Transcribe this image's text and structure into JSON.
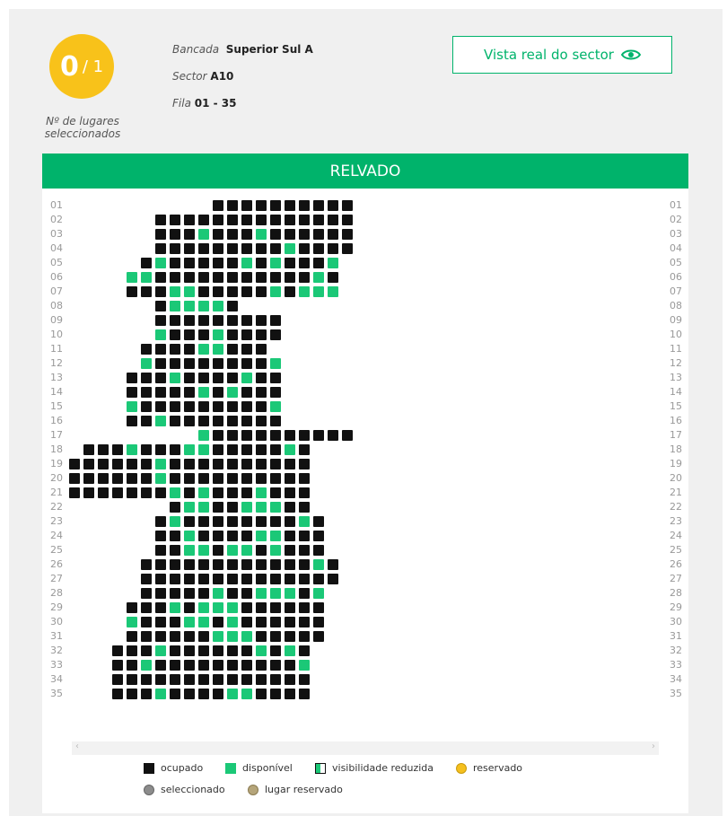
{
  "counter": {
    "selected": "0",
    "total": "/ 1",
    "label_line1": "Nº de lugares",
    "label_line2": "seleccionados"
  },
  "info": {
    "bancada_key": "Bancada",
    "bancada_value": "Superior Sul A",
    "sector_key": "Sector",
    "sector_value": "A10",
    "fila_key": "Fila",
    "fila_value": "01 - 35"
  },
  "view_button": {
    "label": "Vista real do sector",
    "icon": "eye-icon"
  },
  "pitch_label": "RELVADO",
  "rows": [
    {
      "label": "01",
      "start": 5,
      "seats": "oooooooooo"
    },
    {
      "label": "02",
      "start": 1,
      "seats": "oooooooooooooo"
    },
    {
      "label": "03",
      "start": 1,
      "seats": "oooaoooaoooooo"
    },
    {
      "label": "04",
      "start": 1,
      "seats": "oooooooooaoooo"
    },
    {
      "label": "05",
      "start": 0,
      "seats": "oaoooooaoaoooa"
    },
    {
      "label": "06",
      "start": -1,
      "seats": "aaoooooooooooao"
    },
    {
      "label": "07",
      "start": -1,
      "seats": "oooaaoooooaoaaa"
    },
    {
      "label": "08",
      "start": 1,
      "seats": "oaaaao"
    },
    {
      "label": "09",
      "start": 1,
      "seats": "ooooooooo"
    },
    {
      "label": "10",
      "start": 1,
      "seats": "aoooaoooo"
    },
    {
      "label": "11",
      "start": 0,
      "seats": "ooooaaooo"
    },
    {
      "label": "12",
      "start": 0,
      "seats": "aooooooooa"
    },
    {
      "label": "13",
      "start": -1,
      "seats": "oooaooooaoo"
    },
    {
      "label": "14",
      "start": -1,
      "seats": "oooooaoaooo"
    },
    {
      "label": "15",
      "start": -1,
      "seats": "aoooooooooa"
    },
    {
      "label": "16",
      "start": -1,
      "seats": "ooaoooooooo"
    },
    {
      "label": "17",
      "start": 4,
      "seats": "aoooooooooo"
    },
    {
      "label": "18",
      "start": -4,
      "seats": "oooaoooaaoooooao"
    },
    {
      "label": "19",
      "start": -5,
      "seats": "ooooooaoooooooooo"
    },
    {
      "label": "20",
      "start": -5,
      "seats": "ooooooaoooooooooo"
    },
    {
      "label": "21",
      "start": -5,
      "seats": "oooooooaoaoooaooo"
    },
    {
      "label": "22",
      "start": 2,
      "seats": "oaaooaaaoo"
    },
    {
      "label": "23",
      "start": 1,
      "seats": "oaooooooooao"
    },
    {
      "label": "24",
      "start": 1,
      "seats": "ooaooooaaooo"
    },
    {
      "label": "25",
      "start": 1,
      "seats": "ooaaoaaoaooo"
    },
    {
      "label": "26",
      "start": 0,
      "seats": "ooooooooooooao"
    },
    {
      "label": "27",
      "start": 0,
      "seats": "oooooooooooooo"
    },
    {
      "label": "28",
      "start": 0,
      "seats": "oooooaooaaaoa"
    },
    {
      "label": "29",
      "start": -1,
      "seats": "oooaoaaaoooooo"
    },
    {
      "label": "30",
      "start": -1,
      "seats": "aoooaaoaoooooo"
    },
    {
      "label": "31",
      "start": -1,
      "seats": "ooooooaaaooooo"
    },
    {
      "label": "32",
      "start": -2,
      "seats": "oooaooooooaoao"
    },
    {
      "label": "33",
      "start": -2,
      "seats": "ooaooooooooooa"
    },
    {
      "label": "34",
      "start": -2,
      "seats": "oooooooooooooo"
    },
    {
      "label": "35",
      "start": -2,
      "seats": "oooaooooaaoooo"
    }
  ],
  "legend": {
    "occupied": "ocupado",
    "available": "disponível",
    "reduced": "visibilidade reduzida",
    "reserved": "reservado",
    "selected": "seleccionado",
    "seat_reserved": "lugar reservado"
  },
  "colors": {
    "brand_green": "#00b36b",
    "available": "#1bc877",
    "occupied": "#111111",
    "counter_yellow": "#f8c21a",
    "reserved_yellow": "#f5c01e",
    "selected_gray": "#8c8c8c",
    "seat_reserved_tan": "#b5a57a"
  }
}
